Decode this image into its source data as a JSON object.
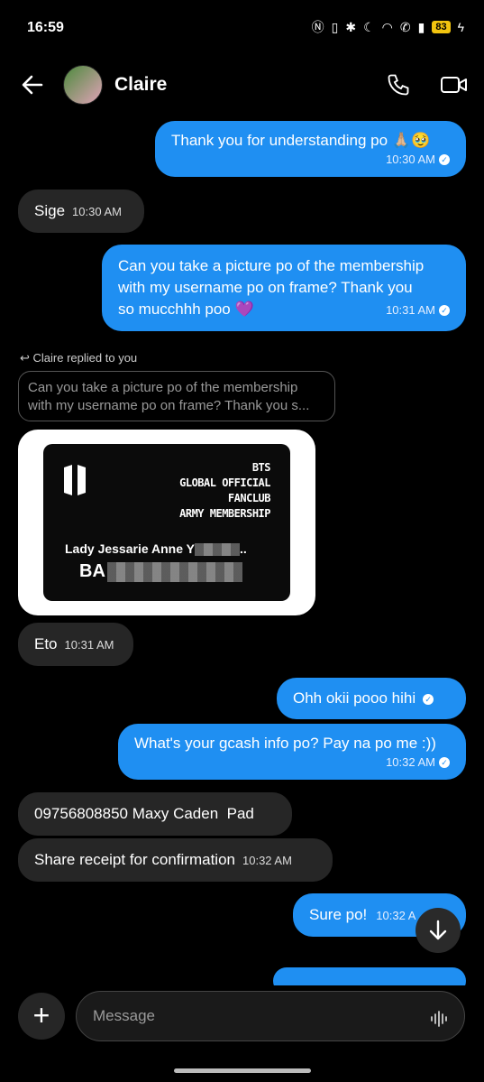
{
  "status_bar": {
    "time": "16:59",
    "battery": "83"
  },
  "header": {
    "contact_name": "Claire"
  },
  "messages": [
    {
      "text": "Thank you for understanding po 🙏🏼🥹",
      "time": "10:30 AM"
    },
    {
      "text": "Sige",
      "time": "10:30 AM"
    },
    {
      "text_lines": [
        "Can you take a picture po of the membership",
        "with my username po on frame? Thank you",
        "so mucchhh poo 💜"
      ],
      "time": "10:31 AM"
    },
    {
      "reply_label": "Claire replied to you",
      "quote_lines": [
        "Can you take a picture po of the membership",
        "with my username po on frame? Thank you s..."
      ]
    },
    {
      "card": {
        "lines": [
          "BTS",
          "GLOBAL OFFICIAL",
          "FANCLUB",
          "ARMY MEMBERSHIP"
        ],
        "name": "Lady Jessarie Anne Y",
        "name_tail": "..",
        "id_prefix": "BA"
      }
    },
    {
      "text": "Eto",
      "time": "10:31 AM"
    },
    {
      "text": "Ohh okii pooo hihi"
    },
    {
      "text": "What's your gcash info po? Pay na po me :))",
      "time": "10:32 AM"
    },
    {
      "text": "09756808850 Maxy Caden  Pad"
    },
    {
      "text": "Share receipt for confirmation",
      "time": "10:32 AM"
    },
    {
      "text": "Sure po!",
      "time": "10:32 A"
    }
  ],
  "composer": {
    "placeholder": "Message"
  }
}
